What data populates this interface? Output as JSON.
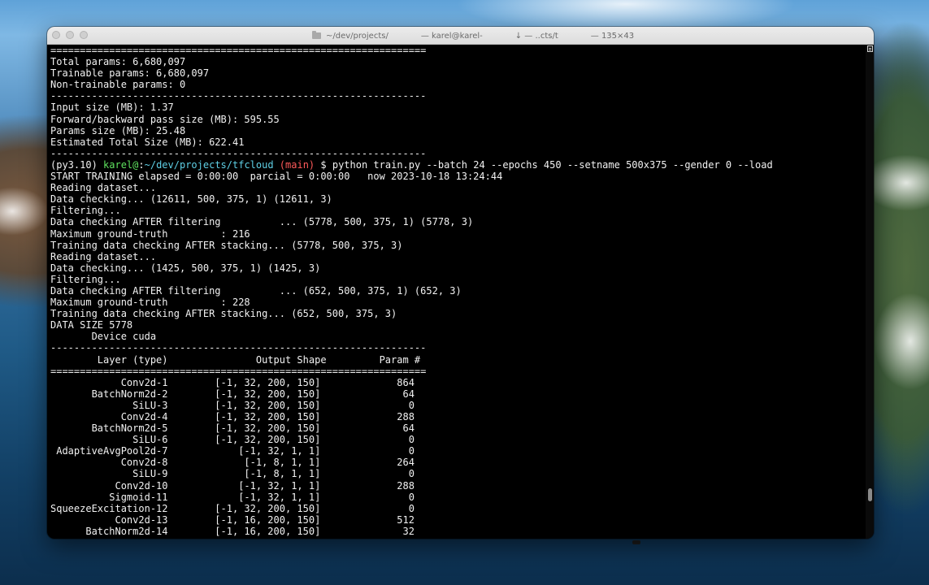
{
  "window": {
    "title_dir": "~/dev/projects/",
    "title_user": "— karel@karel-",
    "title_path": "↓ — ..cts/t",
    "title_size": "— 135×43"
  },
  "colors": {
    "prompt_user": "#5fe35f",
    "prompt_path": "#5fd0e6",
    "prompt_branch": "#ff5a5a"
  },
  "terminal": {
    "header_lines": [
      "================================================================",
      "Total params: 6,680,097",
      "Trainable params: 6,680,097",
      "Non-trainable params: 0",
      "----------------------------------------------------------------",
      "Input size (MB): 1.37",
      "Forward/backward pass size (MB): 595.55",
      "Params size (MB): 25.48",
      "Estimated Total Size (MB): 622.41",
      "----------------------------------------------------------------"
    ],
    "prompt": {
      "env": "(py3.10) ",
      "user": "karel@",
      "sep": ":",
      "path": "~/dev/projects/tfcloud",
      "branch": " (main)",
      "dollar": " $ ",
      "command": "python train.py --batch 24 --epochs 450 --setname 500x375 --gender 0 --load"
    },
    "output_lines": [
      "START TRAINING elapsed = 0:00:00  parcial = 0:00:00   now 2023-10-18 13:24:44",
      "Reading dataset...",
      "Data checking... (12611, 500, 375, 1) (12611, 3)",
      "Filtering...",
      "Data checking AFTER filtering          ... (5778, 500, 375, 1) (5778, 3)",
      "Maximum ground-truth         : 216",
      "Training data checking AFTER stacking... (5778, 500, 375, 3)",
      "Reading dataset...",
      "Data checking... (1425, 500, 375, 1) (1425, 3)",
      "Filtering...",
      "Data checking AFTER filtering          ... (652, 500, 375, 1) (652, 3)",
      "Maximum ground-truth         : 228",
      "Training data checking AFTER stacking... (652, 500, 375, 3)",
      "DATA SIZE 5778",
      "       Device cuda",
      "----------------------------------------------------------------",
      "        Layer (type)               Output Shape         Param #",
      "================================================================",
      "            Conv2d-1        [-1, 32, 200, 150]             864",
      "       BatchNorm2d-2        [-1, 32, 200, 150]              64",
      "              SiLU-3        [-1, 32, 200, 150]               0",
      "            Conv2d-4        [-1, 32, 200, 150]             288",
      "       BatchNorm2d-5        [-1, 32, 200, 150]              64",
      "              SiLU-6        [-1, 32, 200, 150]               0",
      " AdaptiveAvgPool2d-7            [-1, 32, 1, 1]               0",
      "            Conv2d-8             [-1, 8, 1, 1]             264",
      "              SiLU-9             [-1, 8, 1, 1]               0",
      "           Conv2d-10            [-1, 32, 1, 1]             288",
      "          Sigmoid-11            [-1, 32, 1, 1]               0",
      "SqueezeExcitation-12        [-1, 32, 200, 150]               0",
      "           Conv2d-13        [-1, 16, 200, 150]             512",
      "      BatchNorm2d-14        [-1, 16, 200, 150]              32"
    ]
  }
}
